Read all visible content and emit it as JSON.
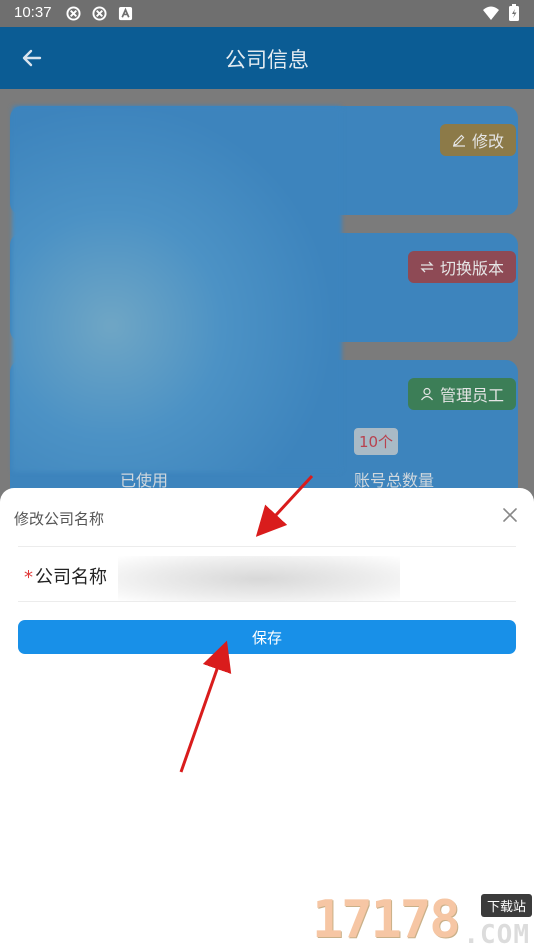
{
  "status_bar": {
    "time": "10:37"
  },
  "app_bar": {
    "title": "公司信息"
  },
  "background_cards": {
    "edit_label": "修改",
    "switch_label": "切换版本",
    "staff_label": "管理员工",
    "account_count": "10个",
    "used_label": "已使用",
    "total_label": "账号总数量"
  },
  "dialog": {
    "title": "修改公司名称",
    "field_required_mark": "*",
    "field_label": "公司名称",
    "field_value": "",
    "save_label": "保存"
  },
  "watermark": {
    "number": "17178",
    "tag": "下载站",
    "domain": ".COM"
  },
  "colors": {
    "app_bar": "#0b5c94",
    "primary_button": "#1890e8",
    "required": "#e03a3a"
  }
}
